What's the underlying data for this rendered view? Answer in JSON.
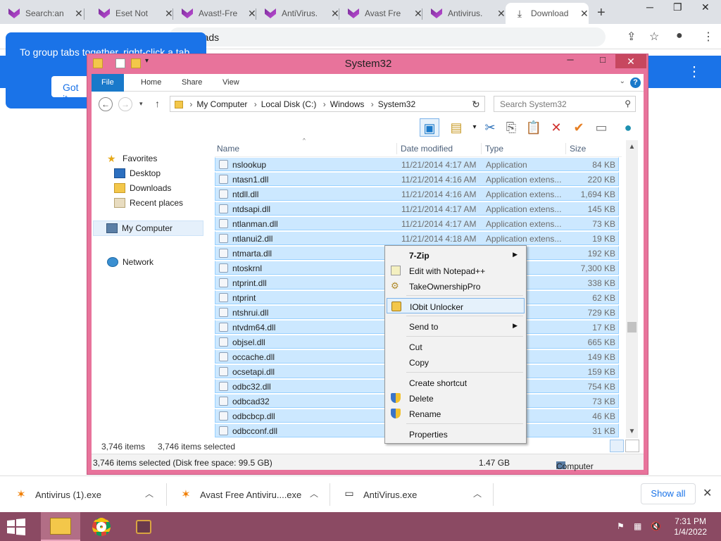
{
  "tabs": [
    {
      "title": "Search:an"
    },
    {
      "title": "Eset Not"
    },
    {
      "title": "Avast!-Fre"
    },
    {
      "title": "AntiVirus."
    },
    {
      "title": "Avast Fre"
    },
    {
      "title": "Antivirus."
    },
    {
      "title": "Download"
    }
  ],
  "omnibox": {
    "text": "ownloads"
  },
  "bubble": {
    "text": "To group tabs together, right-click a tab",
    "button": "Got it"
  },
  "explorer": {
    "title": "System32",
    "ribbon_tabs": [
      "File",
      "Home",
      "Share",
      "View"
    ],
    "help": "?",
    "breadcrumb": [
      "My Computer",
      "Local Disk (C:)",
      "Windows",
      "System32"
    ],
    "search_placeholder": "Search System32",
    "nav": {
      "favorites": "Favorites",
      "desktop": "Desktop",
      "downloads": "Downloads",
      "recent": "Recent places",
      "computer": "My Computer",
      "network": "Network"
    },
    "columns": {
      "name": "Name",
      "date": "Date modified",
      "type": "Type",
      "size": "Size"
    },
    "files": [
      {
        "name": "nslookup",
        "date": "11/21/2014 4:17 AM",
        "type": "Application",
        "size": "84 KB"
      },
      {
        "name": "ntasn1.dll",
        "date": "11/21/2014 4:16 AM",
        "type": "Application extens...",
        "size": "220 KB"
      },
      {
        "name": "ntdll.dll",
        "date": "11/21/2014 4:16 AM",
        "type": "Application extens...",
        "size": "1,694 KB"
      },
      {
        "name": "ntdsapi.dll",
        "date": "11/21/2014 4:17 AM",
        "type": "Application extens...",
        "size": "145 KB"
      },
      {
        "name": "ntlanman.dll",
        "date": "11/21/2014 4:17 AM",
        "type": "Application extens...",
        "size": "73 KB"
      },
      {
        "name": "ntlanui2.dll",
        "date": "11/21/2014 4:18 AM",
        "type": "Application extens...",
        "size": "19 KB"
      },
      {
        "name": "ntmarta.dll",
        "date": "",
        "type": "extens...",
        "size": "192 KB"
      },
      {
        "name": "ntoskrnl",
        "date": "",
        "type": "",
        "size": "7,300 KB"
      },
      {
        "name": "ntprint.dll",
        "date": "",
        "type": "extens...",
        "size": "338 KB"
      },
      {
        "name": "ntprint",
        "date": "",
        "type": "",
        "size": "62 KB"
      },
      {
        "name": "ntshrui.dll",
        "date": "",
        "type": "extens...",
        "size": "729 KB"
      },
      {
        "name": "ntvdm64.dll",
        "date": "",
        "type": "extens...",
        "size": "17 KB"
      },
      {
        "name": "objsel.dll",
        "date": "",
        "type": "extens...",
        "size": "665 KB"
      },
      {
        "name": "occache.dll",
        "date": "",
        "type": "extens...",
        "size": "149 KB"
      },
      {
        "name": "ocsetapi.dll",
        "date": "",
        "type": "extens...",
        "size": "159 KB"
      },
      {
        "name": "odbc32.dll",
        "date": "",
        "type": "extens...",
        "size": "754 KB"
      },
      {
        "name": "odbcad32",
        "date": "",
        "type": "",
        "size": "73 KB"
      },
      {
        "name": "odbcbcp.dll",
        "date": "",
        "type": "extens...",
        "size": "46 KB"
      },
      {
        "name": "odbcconf.dll",
        "date": "",
        "type": "extens...",
        "size": "31 KB"
      }
    ],
    "status": {
      "items": "3,746 items",
      "selected": "3,746 items selected"
    },
    "details": {
      "left": "3,746 items selected (Disk free space: 99.5 GB)",
      "size": "1.47 GB",
      "location": "Computer"
    }
  },
  "context_menu": {
    "items": [
      {
        "label": "7-Zip"
      },
      {
        "label": "Edit with Notepad++"
      },
      {
        "label": "TakeOwnershipPro"
      },
      {
        "label": "IObit Unlocker"
      },
      {
        "label": "Send to"
      },
      {
        "label": "Cut"
      },
      {
        "label": "Copy"
      },
      {
        "label": "Create shortcut"
      },
      {
        "label": "Delete"
      },
      {
        "label": "Rename"
      },
      {
        "label": "Properties"
      }
    ]
  },
  "downloads": [
    {
      "name": "Antivirus (1).exe"
    },
    {
      "name": "Avast Free Antiviru....exe"
    },
    {
      "name": "AntiVirus.exe"
    }
  ],
  "show_all": "Show all",
  "clock": {
    "time": "7:31 PM",
    "date": "1/4/2022"
  },
  "colors": {
    "window_frame": "#e8739b",
    "selection": "#cce8ff",
    "chrome_blue": "#1a73e8",
    "taskbar": "#8b4a63"
  }
}
